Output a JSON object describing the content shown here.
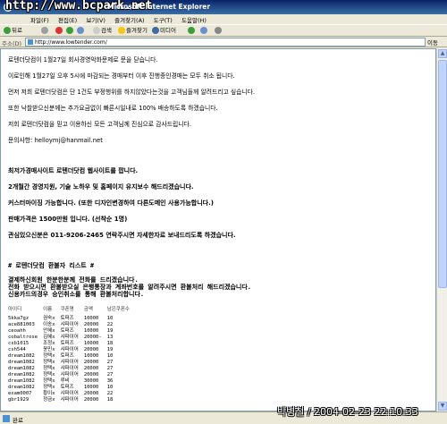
{
  "window": {
    "watermark": "http://www.bcpark.net",
    "title": "Microsoft Internet Explorer"
  },
  "menu": [
    "파일(F)",
    "편집(E)",
    "보기(V)",
    "즐겨찾기(A)",
    "도구(T)",
    "도움말(H)"
  ],
  "toolbar": {
    "back": "뒤로",
    "search": "검색",
    "favorites": "즐겨찾기",
    "media": "미디어"
  },
  "address": {
    "label": "주소(D)",
    "url": "http://www.lowtender.com/",
    "go": "이동"
  },
  "notice": [
    "로텐더닷컴이 1월27일 회사경영악화문제로 문을 닫습니다.",
    "이로인해 1월27일 오후 5시에 마감되는 경매부터 이후 진행중인경매는 모두 취소 됩니다.",
    "먼저 저희 로텐더닷컴은 단 1건도 부정행위를 하지않았다는것을 고객님들께 알려드리고 싶습니다.",
    "또한 낙찰받으신분께는 추가요금없이 빠른시일내로 100% 배송하도록 하겠습니다.",
    "저희 로텐더닷컴을 믿고 이용하신 모든 고객님께 진심으로 감사드립니다.",
    "문의사항: helloymj@hanmail.net"
  ],
  "ad": [
    "최저가경매사이트 로텐더닷컴 웹사이트를 팝니다.",
    "2개월간 경영지원, 기술 노하우 및 홈페이지 유지보수 해드리겠습니다.",
    "커스터마이징 가능합니다. (또한 디자인변경하여 다른도메인 사용가능합니다.)",
    "판매가격은 1500만원 입니다. (선착순 1명)",
    "관심있으신분은 011-9206-2465 연락주시면 자세한자료 보내드리도록 하겠습니다."
  ],
  "refund": [
    "# 로텐더닷컴 환불자 리스트 #",
    "결제하신회원 한분한분께 전화를 드리겠습니다.",
    "전화 받으시면 환불받으실 은행통장과 계좌번호를 알려주시면 환불처리 해드리겠습니다.",
    "신용카드의경우 승인취소를 통해 환불처리합니다."
  ],
  "table": {
    "headers": [
      "아이디",
      "이름",
      "쿠폰명",
      "금액",
      "남은쿠폰수"
    ],
    "rows": [
      [
        "5kka7gz",
        "권숙x",
        "토퍼즈",
        "10000",
        "10"
      ],
      [
        "ace881003",
        "이송x",
        "샤파이어",
        "20000",
        "22"
      ],
      [
        "ceoahh",
        "안혜x",
        "토퍼즈",
        "10000",
        "19"
      ],
      [
        "cobaltrose",
        "김혜x",
        "샤파이어",
        "20000-",
        "13"
      ],
      [
        "csb1015",
        "조정x",
        "토퍼즈",
        "10000",
        "18"
      ],
      [
        "csh544",
        "윤민x",
        "샤파이어",
        "20000",
        "19"
      ],
      [
        "dream1082",
        "정택x",
        "토퍼즈",
        "10000",
        "10"
      ],
      [
        "dream1082",
        "정택x",
        "샤파이어",
        "20000",
        "27"
      ],
      [
        "dream1082",
        "정택x",
        "샤파이어",
        "20000",
        "27"
      ],
      [
        "dream1082",
        "정택x",
        "샤파이어",
        "20000",
        "27"
      ],
      [
        "dream1082",
        "정택x",
        "루비",
        "30000",
        "36"
      ],
      [
        "dream1082",
        "정택x",
        "토퍼즈",
        "10000",
        "10"
      ],
      [
        "exam0007",
        "황이x",
        "샤파이어",
        "20000",
        "22"
      ],
      [
        "gbr1929",
        "정금x",
        "샤파이어",
        "20000",
        "18"
      ]
    ]
  },
  "status": {
    "text": "완료",
    "stamp": "박병철 / 2004-02-23 22:10:33"
  }
}
